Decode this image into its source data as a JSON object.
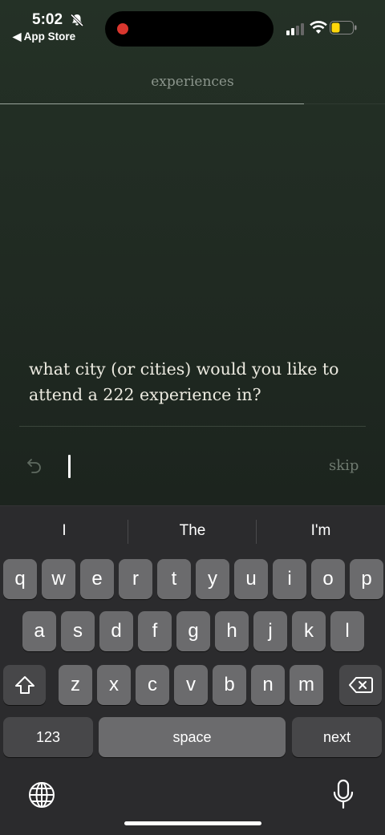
{
  "status_bar": {
    "time": "5:02",
    "back_label": "◀ App Store"
  },
  "header": {
    "title": "experiences",
    "progress": 0.79
  },
  "prompt": {
    "question": "what city (or cities) would you like to attend a 222 experience in?"
  },
  "answer": {
    "value": "",
    "skip_label": "skip"
  },
  "keyboard": {
    "predictions": [
      "I",
      "The",
      "I'm"
    ],
    "row1": [
      "q",
      "w",
      "e",
      "r",
      "t",
      "y",
      "u",
      "i",
      "o",
      "p"
    ],
    "row2": [
      "a",
      "s",
      "d",
      "f",
      "g",
      "h",
      "j",
      "k",
      "l"
    ],
    "row3": [
      "z",
      "x",
      "c",
      "v",
      "b",
      "n",
      "m"
    ],
    "numbers_label": "123",
    "space_label": "space",
    "next_label": "next"
  },
  "colors": {
    "accent_record": "#d9362e",
    "battery_low": "#ffd60a",
    "background": "#202a22"
  }
}
